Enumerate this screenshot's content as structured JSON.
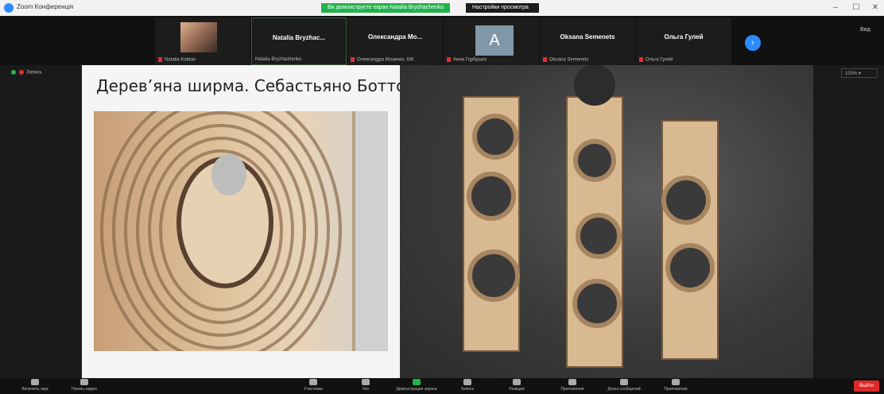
{
  "window": {
    "title": "Zoom Конференція",
    "share_banner": "Ви демонструєте екран Natalia Bryzhachenko",
    "view_options": "Настройки просмотра",
    "minimize": "–",
    "maximize": "☐",
    "close": "✕"
  },
  "gallery": {
    "tiles": [
      {
        "name": "",
        "sub": "Natalia Kobtan"
      },
      {
        "name": "Natalia Bryzhac...",
        "sub": "Natalia Bryzhachenko"
      },
      {
        "name": "Олександра Мо...",
        "sub": "Олександра Мозенко, 6Ж"
      },
      {
        "name": "",
        "sub": "Анна Горбушко",
        "avatar_letter": "A"
      },
      {
        "name": "Oksana Semenets",
        "sub": "Oksana Semenets"
      },
      {
        "name": "Ольга Гулей",
        "sub": "Ольга Гулей"
      }
    ],
    "next_icon": "›",
    "view_label": "Вид"
  },
  "recording": {
    "label": "Запись"
  },
  "zoom": {
    "label": "100% ▾"
  },
  "slide": {
    "title": "Дерев’яна ширма. Себастьяно Боттос."
  },
  "toolbar": {
    "items": [
      {
        "label": "Включить звук",
        "icon": "mic-icon"
      },
      {
        "label": "Начать видео",
        "icon": "video-icon"
      },
      {
        "label": "Участники",
        "icon": "participants-icon"
      },
      {
        "label": "Чат",
        "icon": "chat-icon"
      },
      {
        "label": "Демонстрация экрана",
        "icon": "share-screen-icon"
      },
      {
        "label": "Запись",
        "icon": "record-icon"
      },
      {
        "label": "Реакции",
        "icon": "reactions-icon"
      },
      {
        "label": "Приложения",
        "icon": "apps-icon"
      },
      {
        "label": "Доска сообщений",
        "icon": "whiteboard-icon"
      },
      {
        "label": "Приложения",
        "icon": "more-icon"
      }
    ],
    "leave": "Выйти"
  },
  "colors": {
    "accent": "#2d8cff",
    "share_green": "#22b24c",
    "leave_red": "#e02828"
  }
}
